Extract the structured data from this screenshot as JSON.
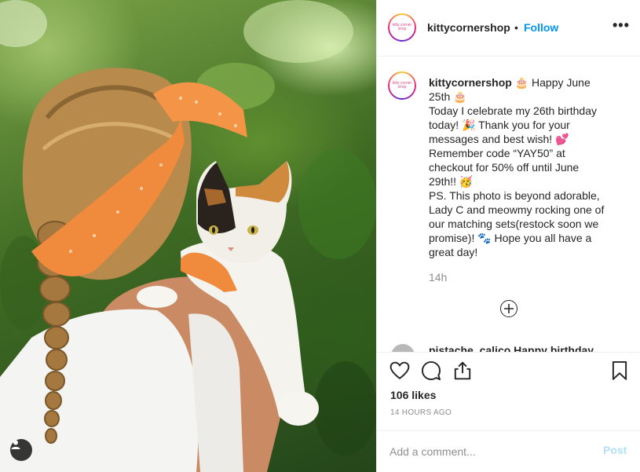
{
  "post": {
    "username": "kittycornershop",
    "follow_label": "Follow",
    "separator": "•",
    "more_label": "•••",
    "avatar_text": "kitty corner shop",
    "caption_lines": [
      " 🎂 Happy June",
      "25th 🎂",
      "Today I celebrate my 26th birthday",
      "today! 🎉 Thank you for your",
      "messages and best wish! 💕",
      "Remember code “YAY50” at",
      "checkout for 50% off until June",
      "29th!! 🥳",
      "PS. This photo is beyond adorable,",
      "Lady C and meowmy rocking one of",
      "our matching sets(restock soon we",
      "promise)! 🐾 Hope you all have a",
      "great day!"
    ],
    "caption_time": "14h",
    "next_comment_preview": "pistache_calico Happy birthday",
    "likes": "106 likes",
    "time_ago": "14 HOURS AGO",
    "comment_placeholder": "Add a comment...",
    "post_button": "Post"
  },
  "icons": {
    "like": "heart-icon",
    "comment": "comment-icon",
    "share": "share-icon",
    "save": "bookmark-icon",
    "add": "plus-circle-icon",
    "user_tag": "user-icon"
  },
  "colors": {
    "follow": "#0095f6",
    "post_disabled": "#b2dffc",
    "muted": "#8e8e8e",
    "border": "#efefef"
  }
}
